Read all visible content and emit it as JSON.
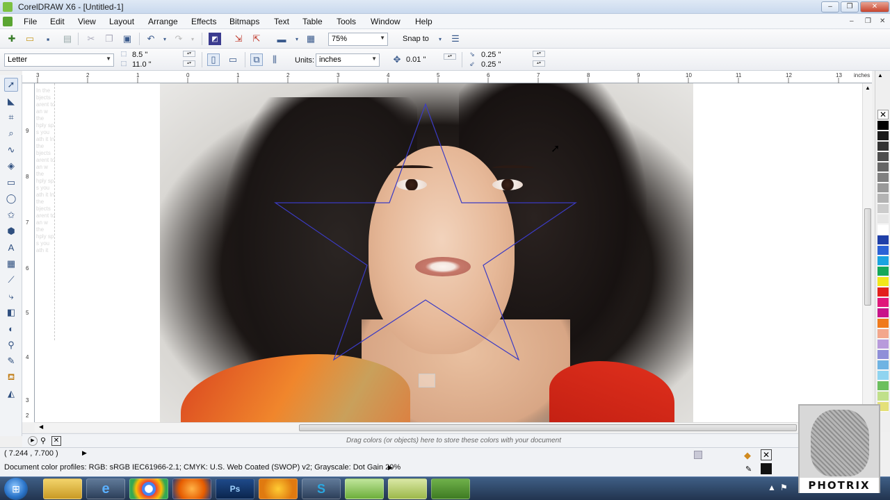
{
  "window": {
    "title": "CorelDRAW X6 - [Untitled-1]",
    "min": "–",
    "max": "❐",
    "close": "✕"
  },
  "menu": [
    "File",
    "Edit",
    "View",
    "Layout",
    "Arrange",
    "Effects",
    "Bitmaps",
    "Text",
    "Table",
    "Tools",
    "Window",
    "Help"
  ],
  "toolbar": {
    "zoom": "75%",
    "snap_to": "Snap to",
    "icons": [
      "new-icon",
      "open-icon",
      "save-icon",
      "print-icon",
      "cut-icon",
      "copy-icon",
      "paste-icon",
      "undo-icon",
      "redo-icon",
      "import-icon",
      "export-icon",
      "publish-icon",
      "application-launcher-icon",
      "welcome-icon",
      "options-icon"
    ]
  },
  "property_bar": {
    "page_size": "Letter",
    "width": "8.5 \"",
    "height": "11.0 \"",
    "units_label": "Units:",
    "units": "inches",
    "nudge": "0.01 \"",
    "dup_x": "0.25 \"",
    "dup_y": "0.25 \""
  },
  "rulers": {
    "units": "inches",
    "h_ticks": [
      "3",
      "2",
      "1",
      "0",
      "1",
      "2",
      "3",
      "4",
      "5",
      "6",
      "7",
      "8",
      "9",
      "10",
      "11",
      "12",
      "13"
    ],
    "v_ticks": [
      "9",
      "8",
      "7",
      "6",
      "5",
      "4",
      "3",
      "2"
    ]
  },
  "toolbox": [
    "pick-tool-icon",
    "shape-tool-icon",
    "crop-tool-icon",
    "zoom-tool-icon",
    "freehand-tool-icon",
    "smart-fill-icon",
    "rectangle-tool-icon",
    "ellipse-tool-icon",
    "polygon-tool-icon",
    "basic-shapes-icon",
    "text-tool-icon",
    "table-tool-icon",
    "dimension-tool-icon",
    "connector-tool-icon",
    "blend-tool-icon",
    "transparency-tool-icon",
    "eyedropper-tool-icon",
    "outline-pen-icon",
    "fill-tool-icon",
    "interactive-fill-icon"
  ],
  "palette": {
    "colors": [
      "#000000",
      "#1a1a1a",
      "#333333",
      "#4d4d4d",
      "#666666",
      "#808080",
      "#999999",
      "#b3b3b3",
      "#cccccc",
      "#e6e6e6",
      "#ffffff",
      "#1f3fa8",
      "#2b62d6",
      "#1aa3e0",
      "#16a85a",
      "#f2e61a",
      "#e3201b",
      "#e0187a",
      "#c8148a",
      "#f07a1c",
      "#f3a78c",
      "#b89adb",
      "#8f8fd8",
      "#6fb3e3",
      "#8fd4f0",
      "#6cbf5e",
      "#c0e08a",
      "#e4e079"
    ]
  },
  "doc_palette_hint": "Drag colors (or objects) here to store these colors with your document",
  "status": {
    "coords": "( 7.244 , 7.700 )",
    "profiles": "Document color profiles: RGB: sRGB IEC61966-2.1; CMYK: U.S. Web Coated (SWOP) v2; Grayscale: Dot Gain 20%"
  },
  "canvas": {
    "star_outline_color": "#3b3bc4"
  },
  "taskbar": {
    "items": [
      {
        "name": "explorer",
        "label": ""
      },
      {
        "name": "internet-explorer",
        "label": "e"
      },
      {
        "name": "chrome",
        "label": ""
      },
      {
        "name": "firefox",
        "label": ""
      },
      {
        "name": "photoshop",
        "label": "Ps"
      },
      {
        "name": "media-player",
        "label": ""
      },
      {
        "name": "skype",
        "label": "S"
      },
      {
        "name": "coreldraw",
        "label": ""
      },
      {
        "name": "corel-capture",
        "label": ""
      },
      {
        "name": "recorder",
        "label": ""
      }
    ]
  },
  "watermark": {
    "text": "PHOTRIX"
  }
}
